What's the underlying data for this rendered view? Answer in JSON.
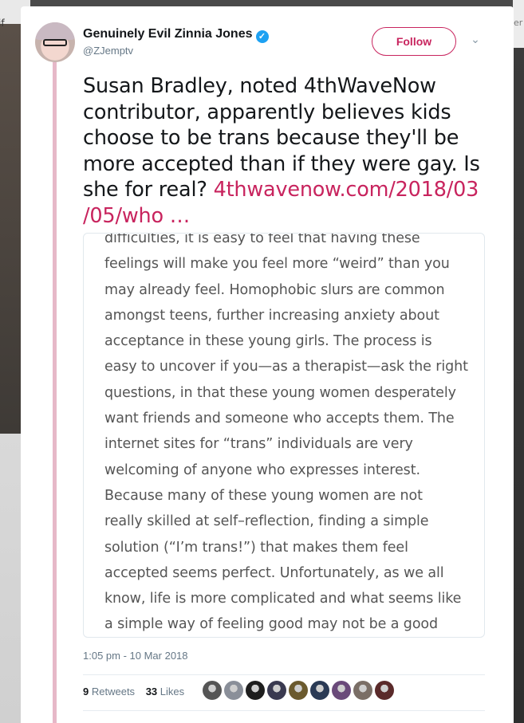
{
  "background": {
    "left_fragment": "if",
    "right_fragment": "er"
  },
  "tweet": {
    "author_name": "Genuinely Evil Zinnia Jones",
    "verified_glyph": "✓",
    "handle": "@ZJemptv",
    "follow_label": "Follow",
    "caret_glyph": "⌄",
    "text_lines": [
      "Susan Bradley, noted 4thWaveNow",
      "contributor, apparently believes kids",
      "choose to be trans because they'll be",
      "more accepted than if they were gay. Is",
      "she for real? "
    ],
    "link_part1": "4thwavenow.com/2018/03",
    "link_part2": "/05/who   …",
    "media_excerpt": [
      "difficulties, it is easy to feel that having these",
      "feelings will make you feel more “weird” than you",
      "may already feel. Homophobic slurs are common",
      "amongst teens, further increasing anxiety about",
      "acceptance in these young girls. The process is",
      "easy to uncover if you—as a therapist—ask the right",
      "questions, in that these young women desperately",
      "want friends and someone who accepts them. The",
      "internet sites for “trans” individuals are very",
      "welcoming of anyone who expresses interest.",
      "Because many of these young women are not",
      "really skilled at self–reflection, finding a simple",
      "solution (“I’m trans!”) that makes them feel",
      "accepted seems perfect. Unfortunately, as we all",
      "know, life is more complicated and what seems like",
      "a simple way of feeling good may not be a good"
    ],
    "timestamp": "1:05 pm - 10 Mar 2018",
    "retweets_count": "9",
    "retweets_label": "Retweets",
    "likes_count": "33",
    "likes_label": "Likes"
  },
  "colors": {
    "link": "#c8245e",
    "thread_line": "#e6b8c8",
    "verified": "#1da1f2"
  },
  "liker_avatars": [
    "#555555",
    "#8a8f99",
    "#1e1e1e",
    "#3a3a50",
    "#6b5a2e",
    "#2a3a55",
    "#6a4a7a",
    "#7a6e66",
    "#5a2a2a"
  ]
}
